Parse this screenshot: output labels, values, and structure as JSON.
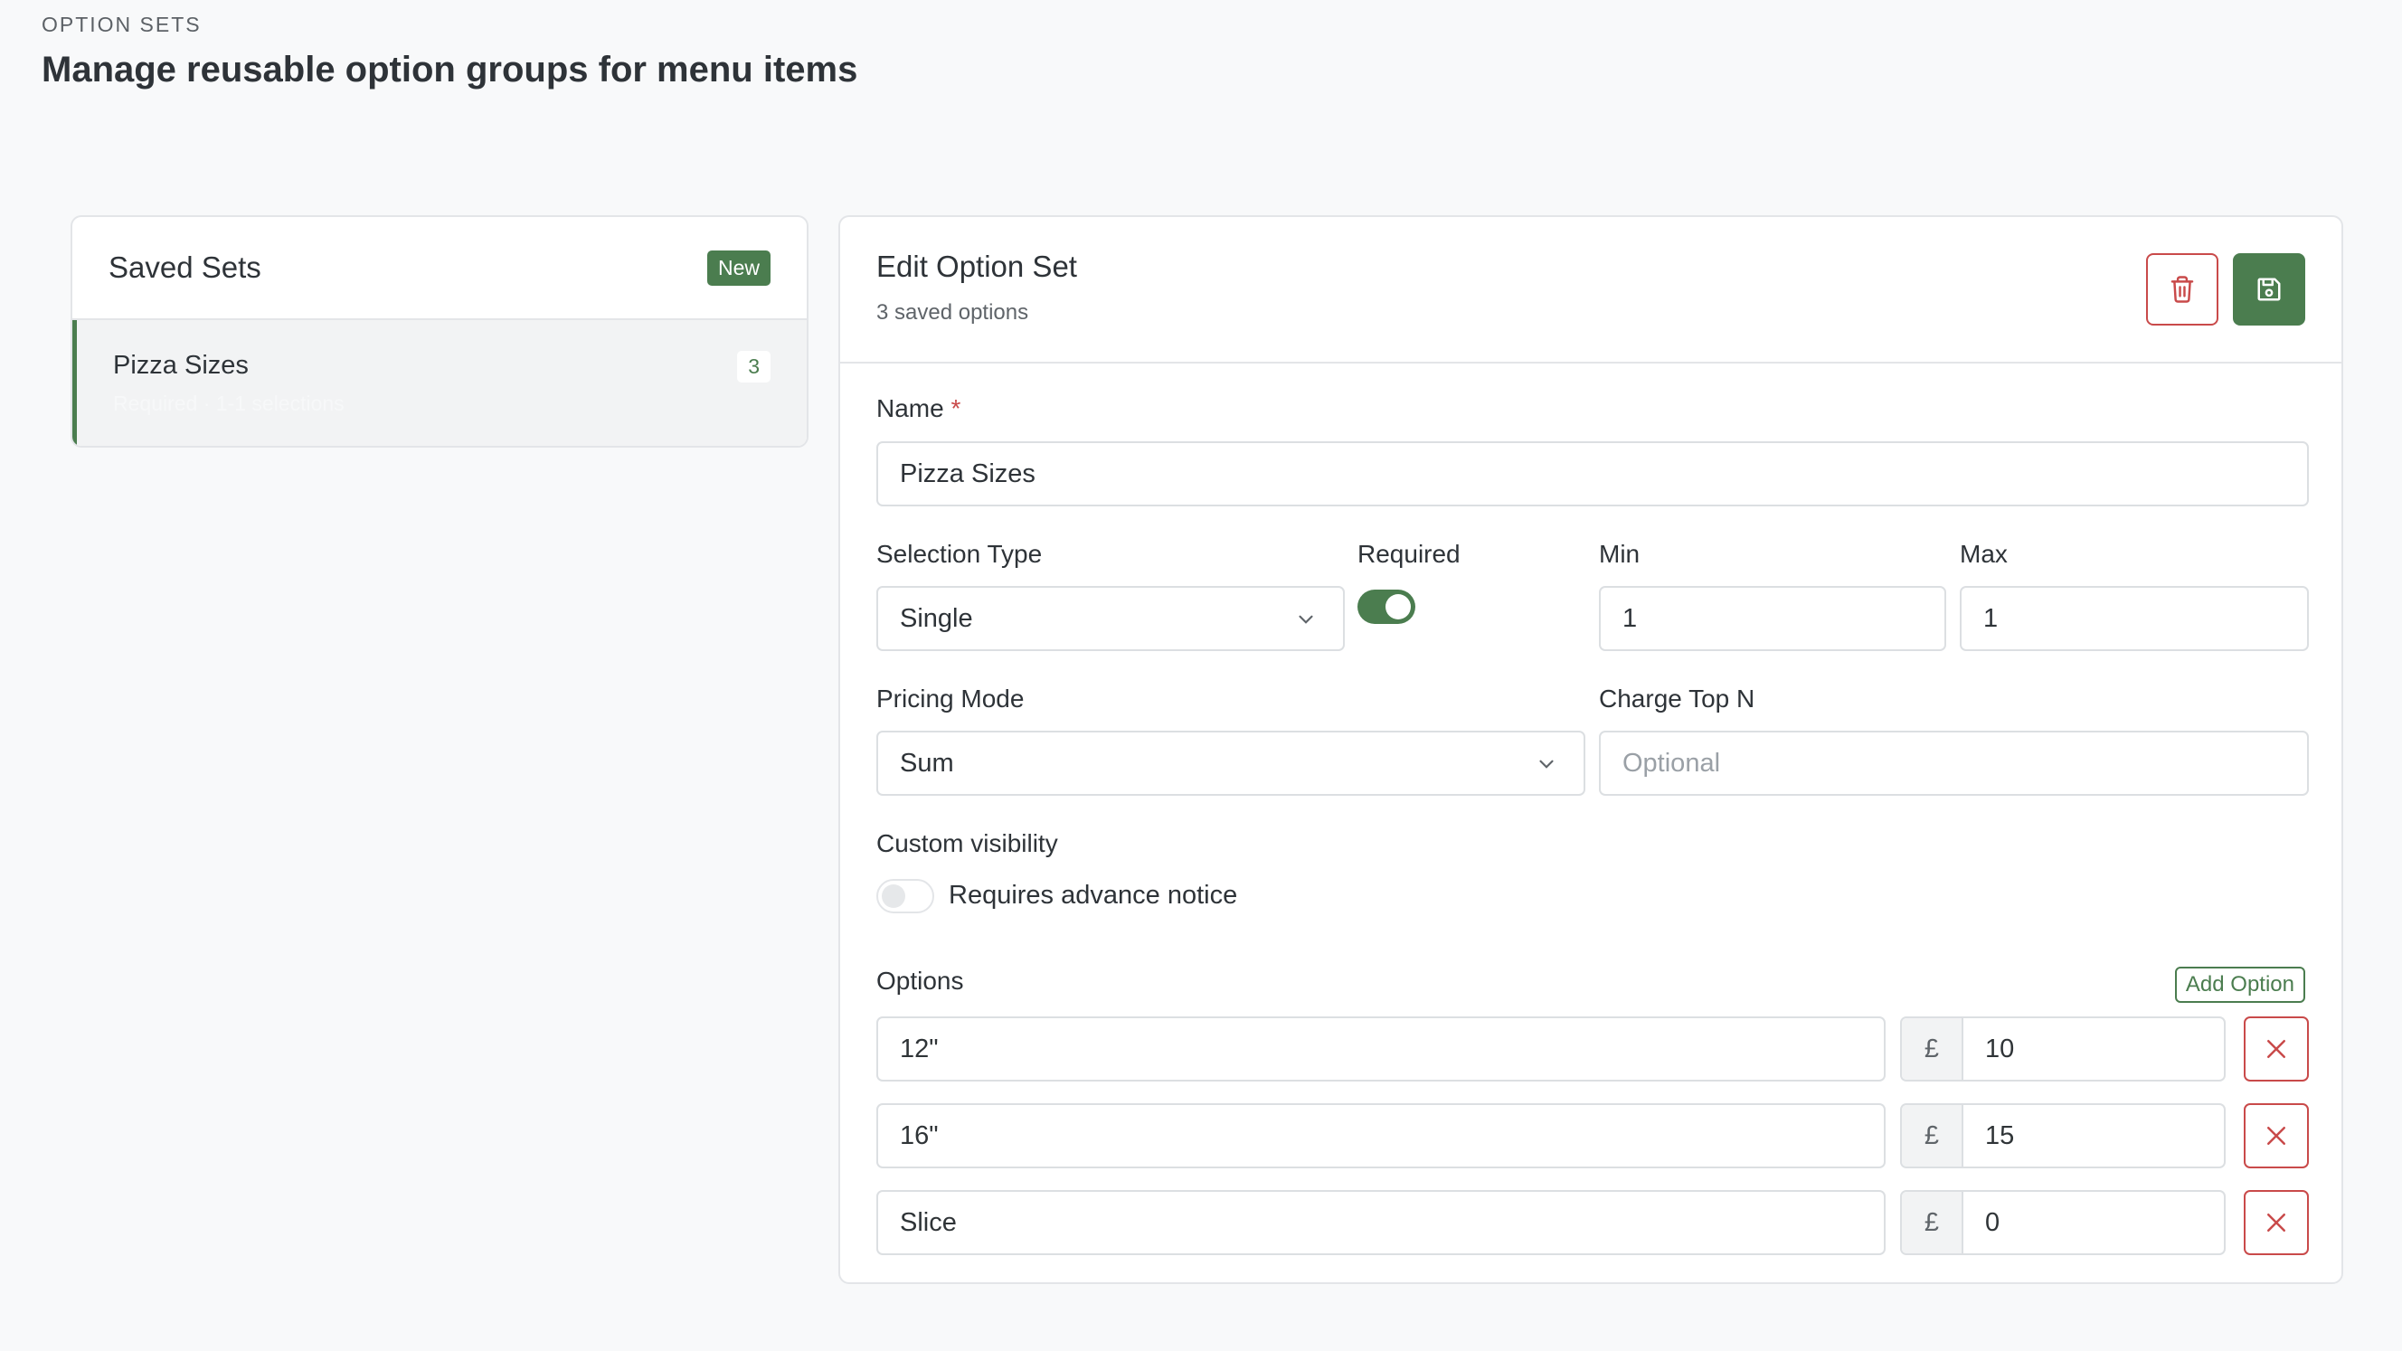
{
  "header": {
    "eyebrow": "OPTION SETS",
    "title": "Manage reusable option groups for menu items"
  },
  "saved_sets": {
    "title": "Saved Sets",
    "new_label": "New",
    "items": [
      {
        "name": "Pizza Sizes",
        "count": "3",
        "subtitle": "Required · 1-1 selections"
      }
    ]
  },
  "editor": {
    "title": "Edit Option Set",
    "subtitle": "3 saved options",
    "name_label": "Name",
    "required_mark": "*",
    "name_value": "Pizza Sizes",
    "selection_type_label": "Selection Type",
    "selection_type_value": "Single",
    "required_label": "Required",
    "required_on": true,
    "min_label": "Min",
    "min_value": "1",
    "max_label": "Max",
    "max_value": "1",
    "pricing_mode_label": "Pricing Mode",
    "pricing_mode_value": "Sum",
    "charge_top_n_label": "Charge Top N",
    "charge_top_n_placeholder": "Optional",
    "custom_visibility_label": "Custom visibility",
    "advance_notice_label": "Requires advance notice",
    "advance_notice_on": false,
    "options_label": "Options",
    "add_option_label": "Add Option",
    "options": [
      {
        "name": "12\"",
        "currency": "£",
        "price": "10"
      },
      {
        "name": "16\"",
        "currency": "£",
        "price": "15"
      },
      {
        "name": "Slice",
        "currency": "£",
        "price": "0"
      }
    ]
  },
  "colors": {
    "accent": "#4b7d4f",
    "danger": "#c94a4a",
    "background": "#f8f9fa"
  },
  "icons": {
    "delete": "trash-icon",
    "save": "save-icon",
    "remove": "close-icon",
    "dropdown": "chevron-down-icon"
  }
}
